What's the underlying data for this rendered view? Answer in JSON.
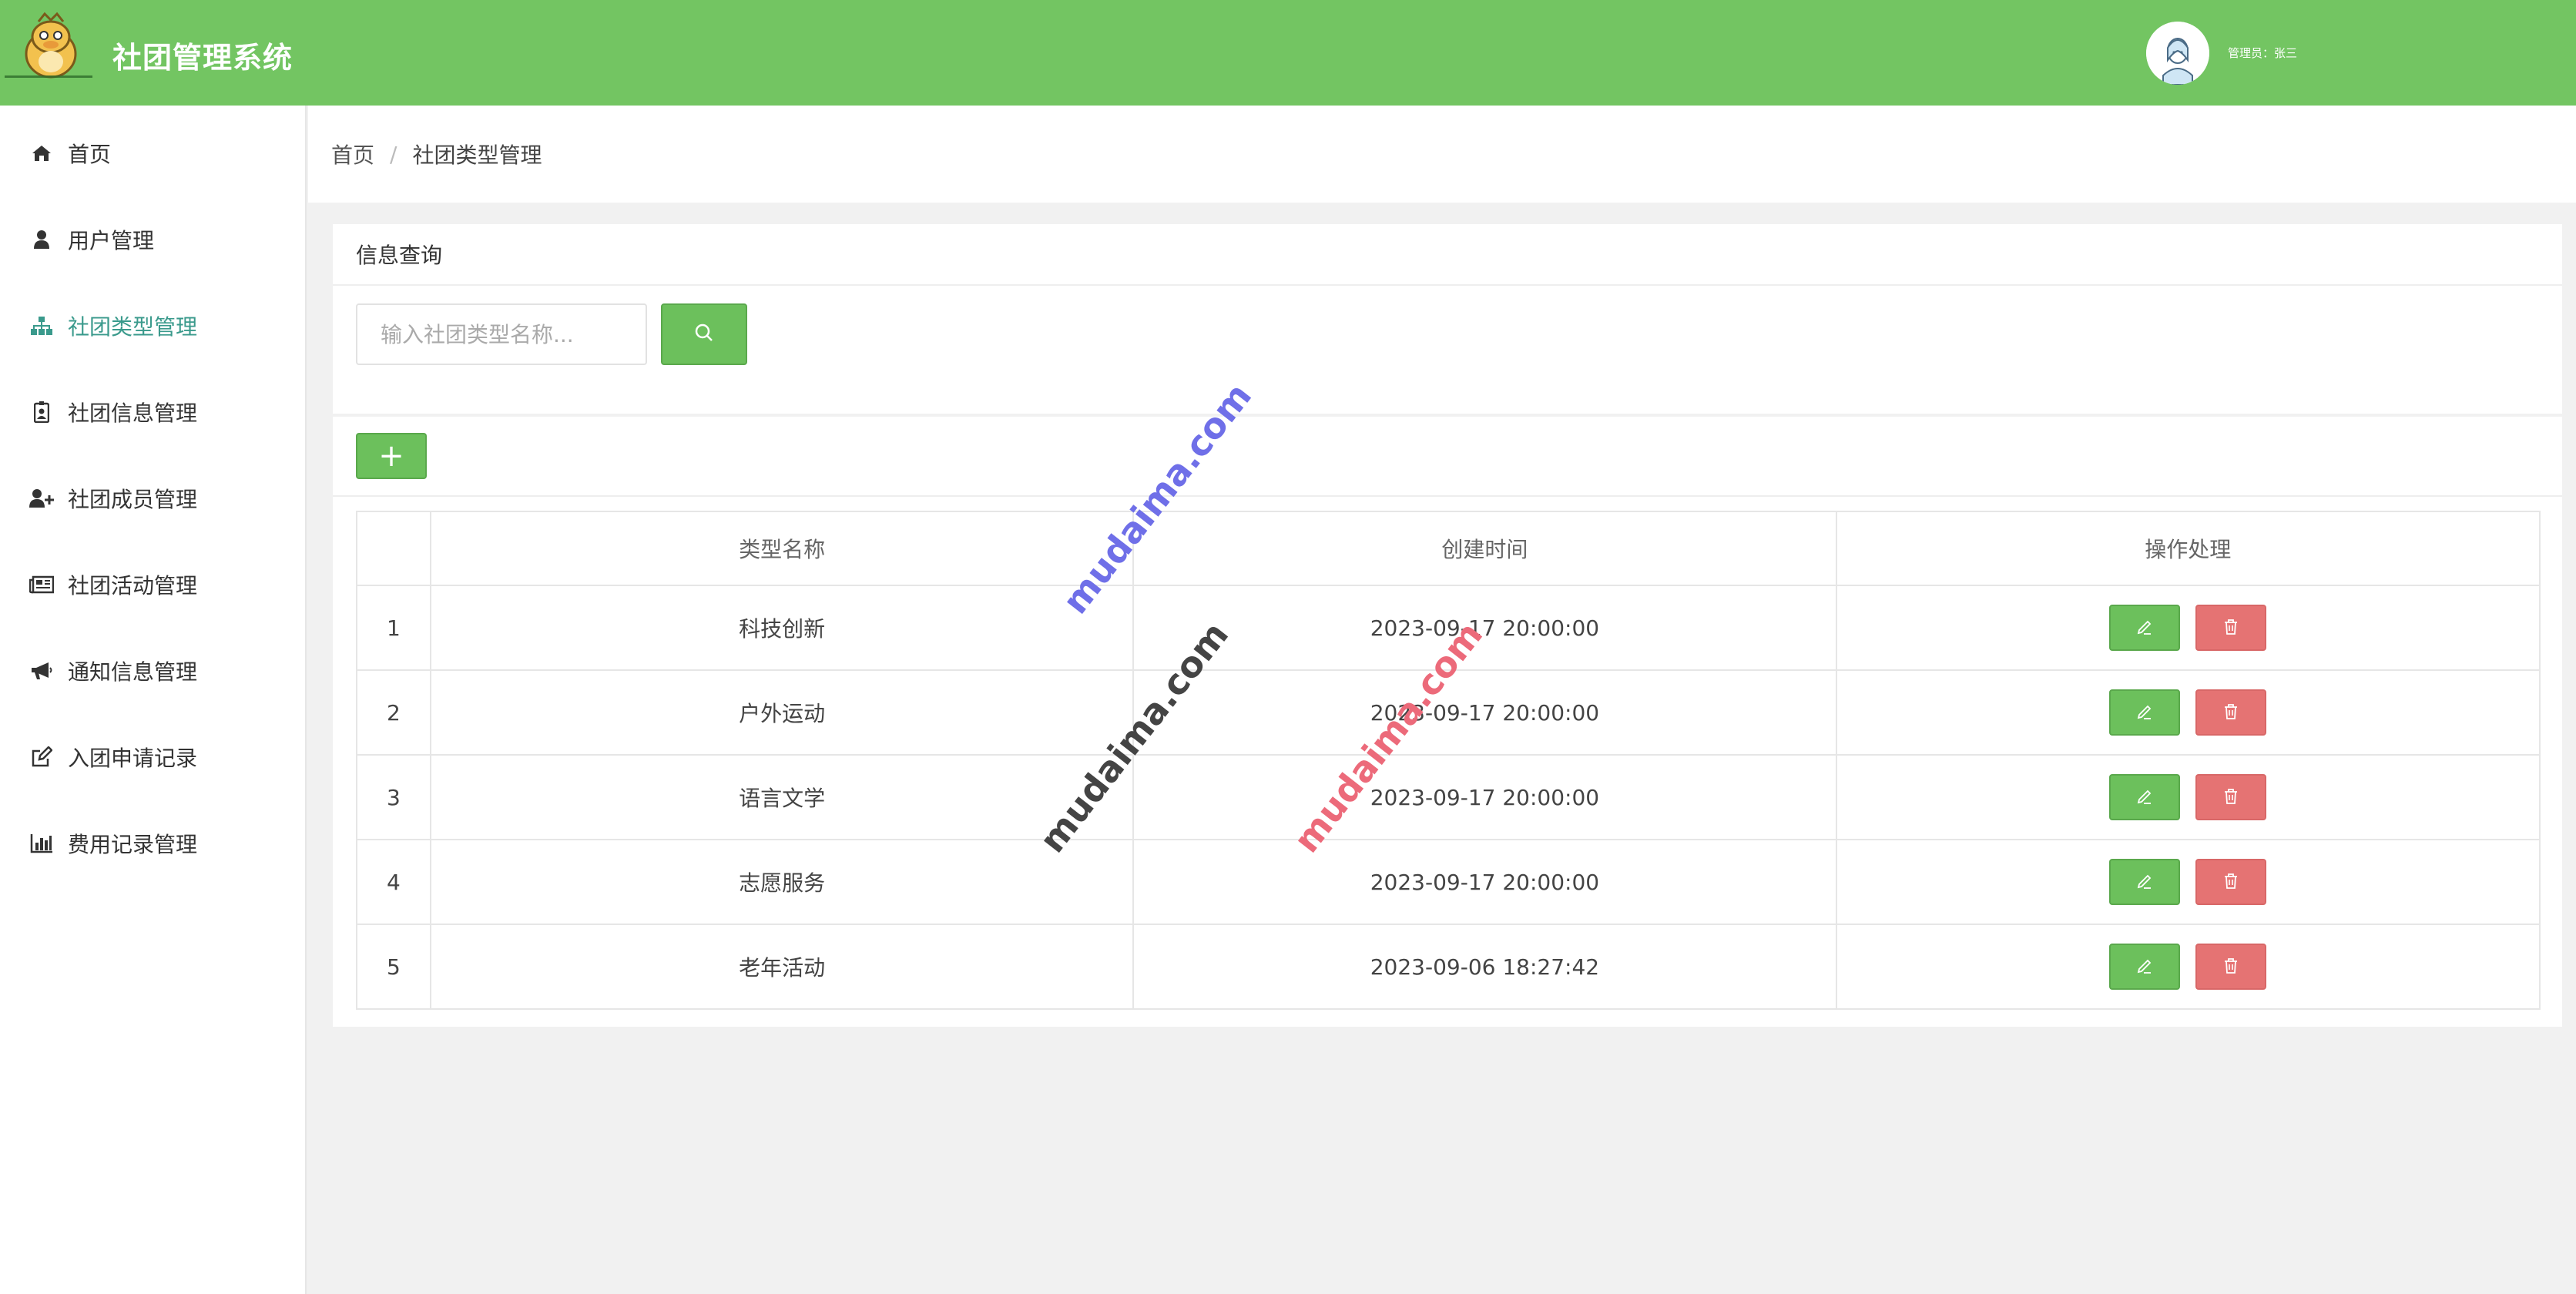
{
  "header": {
    "app_title": "社团管理系统",
    "admin_label": "管理员：张三"
  },
  "sidebar": {
    "items": [
      {
        "label": "首页",
        "icon": "home-icon"
      },
      {
        "label": "用户管理",
        "icon": "user-icon"
      },
      {
        "label": "社团类型管理",
        "icon": "sitemap-icon",
        "active": true
      },
      {
        "label": "社团信息管理",
        "icon": "id-badge-icon"
      },
      {
        "label": "社团成员管理",
        "icon": "user-plus-icon"
      },
      {
        "label": "社团活动管理",
        "icon": "newspaper-icon"
      },
      {
        "label": "通知信息管理",
        "icon": "bullhorn-icon"
      },
      {
        "label": "入团申请记录",
        "icon": "edit-icon"
      },
      {
        "label": "费用记录管理",
        "icon": "bar-chart-icon"
      }
    ]
  },
  "breadcrumb": {
    "home": "首页",
    "separator": "/",
    "current": "社团类型管理"
  },
  "panel": {
    "title": "信息查询",
    "search_placeholder": "输入社团类型名称...",
    "add_label": "+"
  },
  "table": {
    "headers": [
      "",
      "类型名称",
      "创建时间",
      "操作处理"
    ],
    "rows": [
      {
        "index": "1",
        "name": "科技创新",
        "created": "2023-09-17 20:00:00"
      },
      {
        "index": "2",
        "name": "户外运动",
        "created": "2023-09-17 20:00:00"
      },
      {
        "index": "3",
        "name": "语言文学",
        "created": "2023-09-17 20:00:00"
      },
      {
        "index": "4",
        "name": "志愿服务",
        "created": "2023-09-17 20:00:00"
      },
      {
        "index": "5",
        "name": "老年活动",
        "created": "2023-09-06 18:27:42"
      }
    ]
  },
  "watermarks": [
    "mudaima.com",
    "mudaima.com",
    "mudaima.com"
  ],
  "colors": {
    "header_bg": "#73c562",
    "primary_button": "#6cc05c",
    "danger_button": "#e57373",
    "active_nav": "#3a9a8c"
  }
}
